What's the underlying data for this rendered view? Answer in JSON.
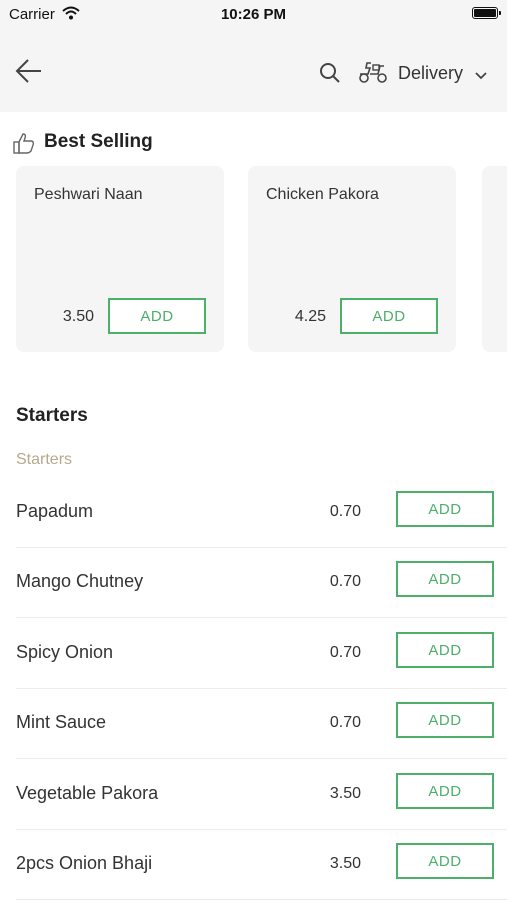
{
  "status_bar": {
    "carrier": "Carrier",
    "time": "10:26 PM"
  },
  "nav": {
    "delivery_label": "Delivery"
  },
  "best_selling": {
    "title": "Best Selling",
    "items": [
      {
        "name": "Peshwari Naan",
        "price": "3.50",
        "add_label": "ADD"
      },
      {
        "name": "Chicken Pakora",
        "price": "4.25",
        "add_label": "ADD"
      }
    ]
  },
  "starters": {
    "title": "Starters",
    "subtitle": "Starters",
    "items": [
      {
        "name": "Papadum",
        "price": "0.70",
        "add_label": "ADD"
      },
      {
        "name": "Mango Chutney",
        "price": "0.70",
        "add_label": "ADD"
      },
      {
        "name": "Spicy Onion",
        "price": "0.70",
        "add_label": "ADD"
      },
      {
        "name": "Mint Sauce",
        "price": "0.70",
        "add_label": "ADD"
      },
      {
        "name": "Vegetable Pakora",
        "price": "3.50",
        "add_label": "ADD"
      },
      {
        "name": "2pcs Onion Bhaji",
        "price": "3.50",
        "add_label": "ADD"
      }
    ]
  },
  "colors": {
    "accent": "#4caf6a",
    "muted_label": "#b6a98c",
    "header_bg": "#f5f5f5",
    "card_bg": "#f5f5f5"
  }
}
